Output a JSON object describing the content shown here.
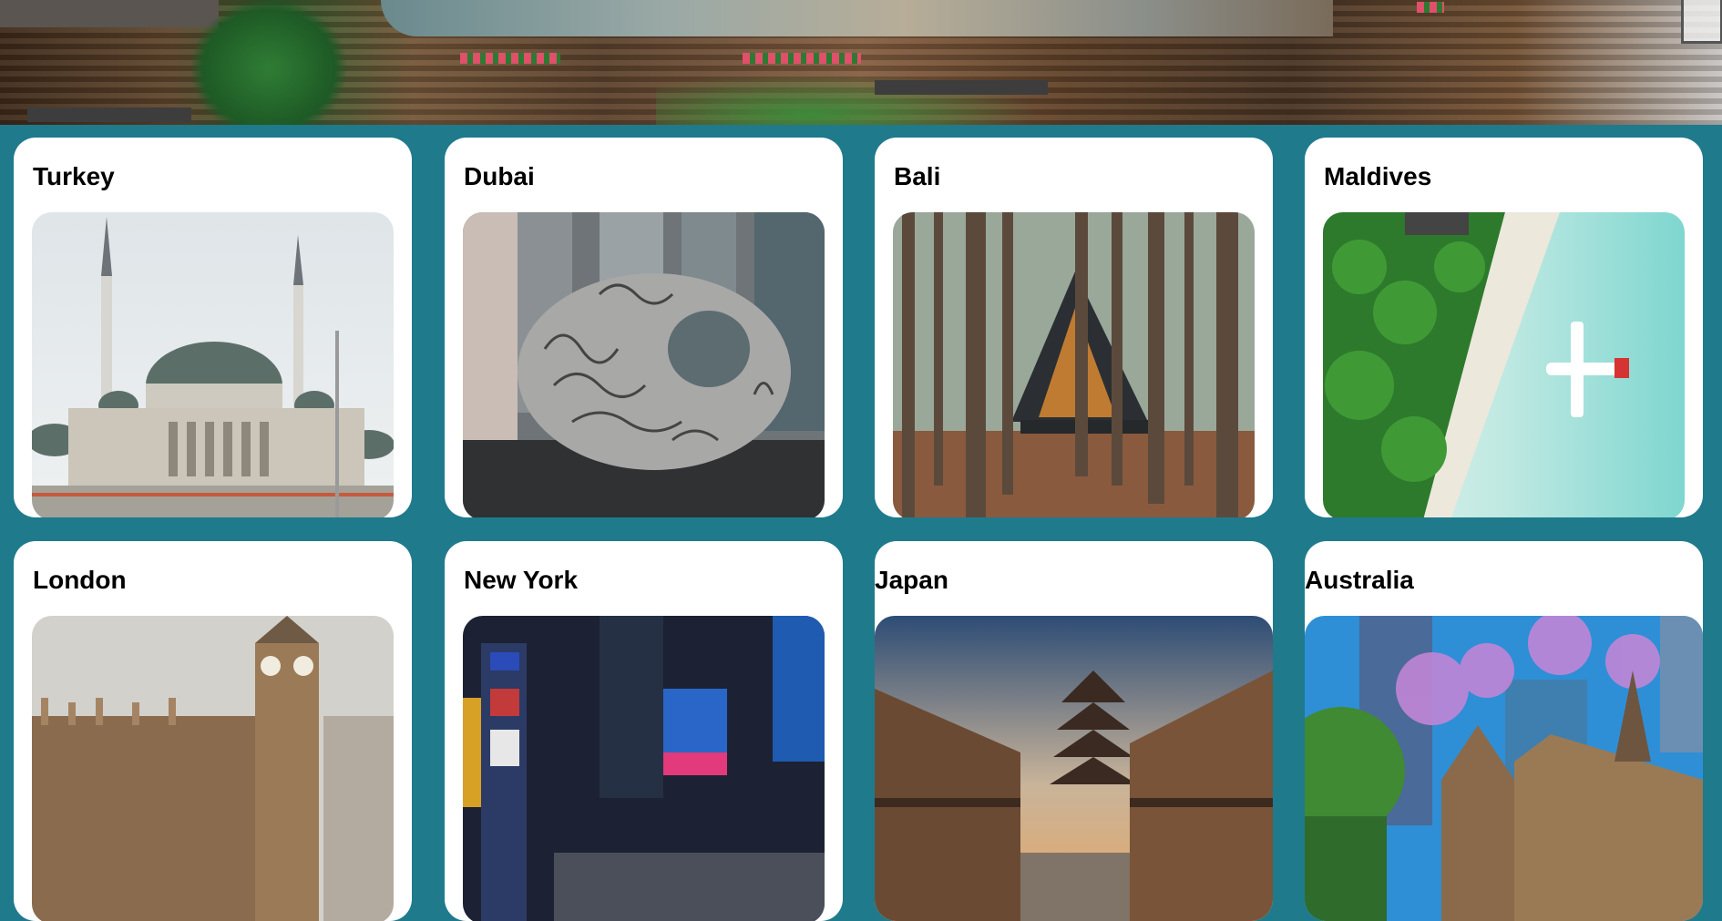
{
  "hero": {
    "image": "chalet-village-banner"
  },
  "destinations": [
    {
      "name": "Turkey",
      "image": "mosque-photo"
    },
    {
      "name": "Dubai",
      "image": "museum-of-the-future-photo"
    },
    {
      "name": "Bali",
      "image": "forest-cabin-photo"
    },
    {
      "name": "Maldives",
      "image": "beach-seaplane-photo"
    },
    {
      "name": "London",
      "image": "big-ben-photo"
    },
    {
      "name": "New York",
      "image": "times-square-photo"
    },
    {
      "name": "Japan",
      "image": "pagoda-street-photo"
    },
    {
      "name": "Australia",
      "image": "jacaranda-city-photo"
    }
  ],
  "colors": {
    "page_background": "#1f7a8c",
    "card_background": "#ffffff"
  }
}
